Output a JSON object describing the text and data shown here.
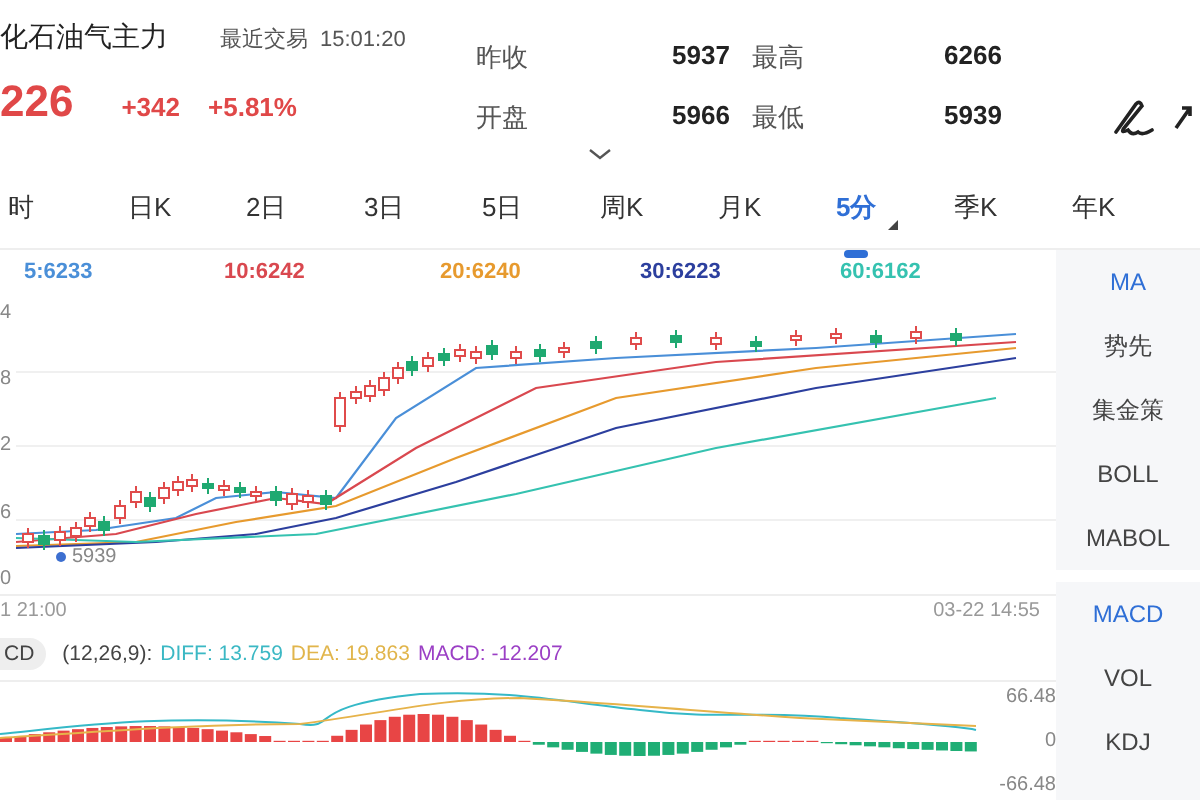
{
  "header": {
    "name": "化石油气主力",
    "last_trade_label": "最近交易",
    "time": "15:01:20",
    "price": "226",
    "change": "+342",
    "change_pct": "+5.81%",
    "stats": [
      {
        "label": "昨收",
        "value": "5937"
      },
      {
        "label": "最高",
        "value": "6266"
      },
      {
        "label": "开盘",
        "value": "5966"
      },
      {
        "label": "最低",
        "value": "5939"
      }
    ]
  },
  "periods": [
    {
      "label": "时",
      "selected": false
    },
    {
      "label": "日K",
      "selected": false
    },
    {
      "label": "2日",
      "selected": false
    },
    {
      "label": "3日",
      "selected": false
    },
    {
      "label": "5日",
      "selected": false
    },
    {
      "label": "周K",
      "selected": false
    },
    {
      "label": "月K",
      "selected": false
    },
    {
      "label": "5分",
      "selected": true
    },
    {
      "label": "季K",
      "selected": false
    },
    {
      "label": "年K",
      "selected": false
    }
  ],
  "ma_legend": [
    {
      "label": "5:6233",
      "color": "#4a8fd8"
    },
    {
      "label": "10:6242",
      "color": "#d9484f"
    },
    {
      "label": "20:6240",
      "color": "#e79a2e"
    },
    {
      "label": "30:6223",
      "color": "#2c3f9e"
    },
    {
      "label": "60:6162",
      "color": "#35c2b0"
    }
  ],
  "chart": {
    "y_labels": [
      "4",
      "8",
      "2",
      "6",
      "0"
    ],
    "low_marker": "5939",
    "start_time": "1 21:00",
    "end_time": "03-22 14:55"
  },
  "macd": {
    "badge": "CD",
    "params": "(12,26,9):",
    "diff": "DIFF: 13.759",
    "dea": "DEA: 19.863",
    "macd": "MACD: -12.207",
    "ticks": [
      "66.48",
      "0",
      "-66.48"
    ]
  },
  "indicators": [
    {
      "label": "MA",
      "selected": true
    },
    {
      "label": "势先",
      "selected": false
    },
    {
      "label": "集金策",
      "selected": false
    },
    {
      "label": "BOLL",
      "selected": false
    },
    {
      "label": "MABOL",
      "selected": false
    },
    {
      "label": "MACD",
      "selected": true
    },
    {
      "label": "VOL",
      "selected": false
    },
    {
      "label": "KDJ",
      "selected": false
    }
  ]
}
